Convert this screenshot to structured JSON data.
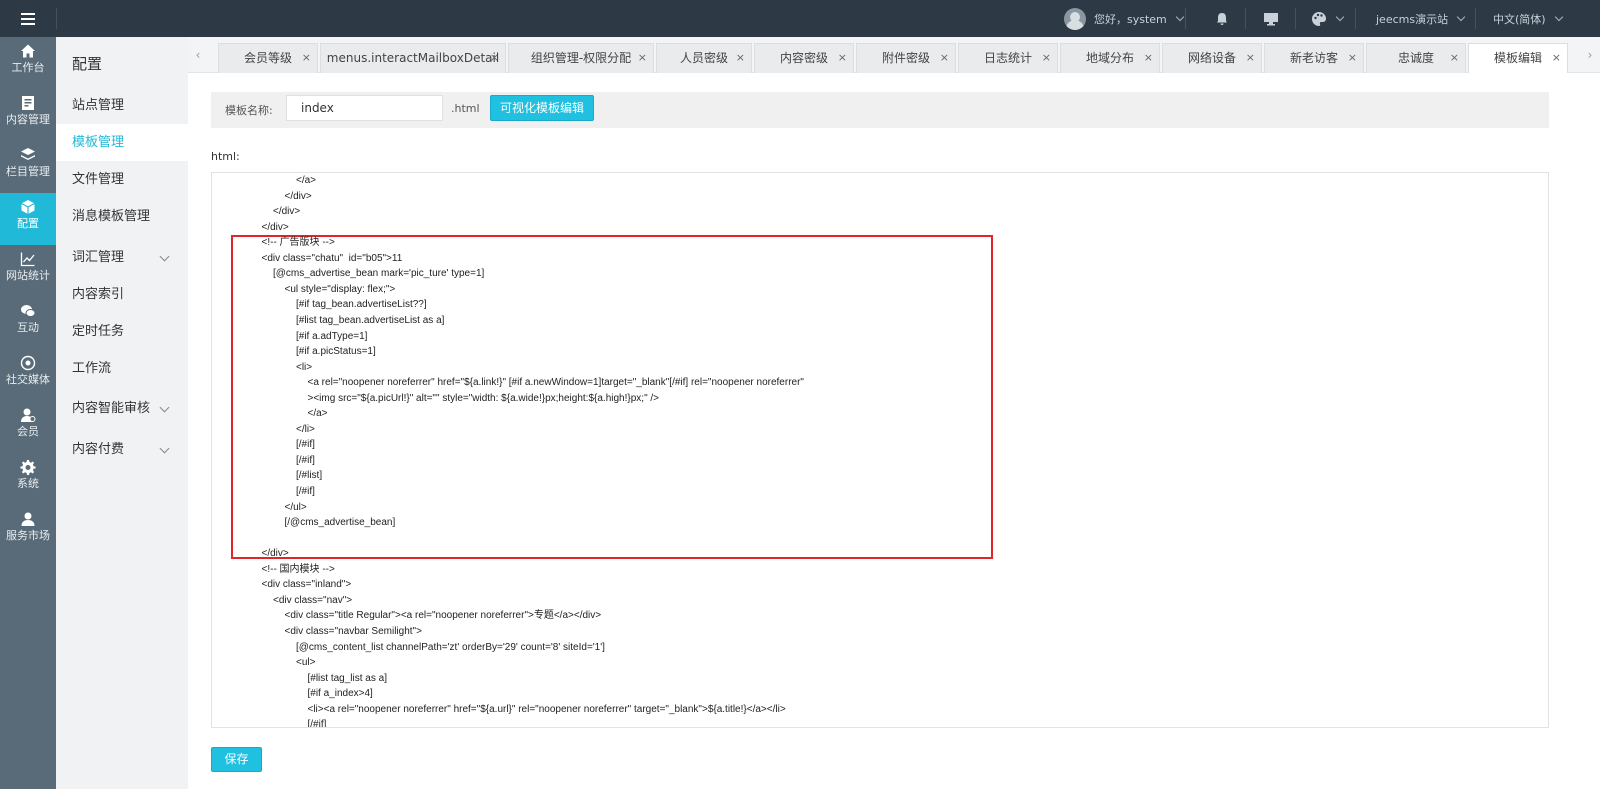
{
  "topbar": {
    "greeting": "您好，system",
    "site_name": "jeecms演示站",
    "language": "中文(简体)"
  },
  "icon_nav": [
    {
      "label": "工作台",
      "icon": "home-icon"
    },
    {
      "label": "内容管理",
      "icon": "document-icon"
    },
    {
      "label": "栏目管理",
      "icon": "layers-icon"
    },
    {
      "label": "配置",
      "icon": "cube-icon",
      "active": true
    },
    {
      "label": "网站统计",
      "icon": "chart-icon"
    },
    {
      "label": "互动",
      "icon": "chat-icon"
    },
    {
      "label": "社交媒体",
      "icon": "target-icon"
    },
    {
      "label": "会员",
      "icon": "member-icon"
    },
    {
      "label": "系统",
      "icon": "gear-icon"
    },
    {
      "label": "服务市场",
      "icon": "service-icon"
    }
  ],
  "sub_nav": {
    "title": "配置",
    "items": [
      {
        "label": "站点管理"
      },
      {
        "label": "模板管理",
        "active": true
      },
      {
        "label": "文件管理"
      },
      {
        "label": "消息模板管理"
      },
      {
        "label": "词汇管理",
        "expandable": true
      },
      {
        "label": "内容索引"
      },
      {
        "label": "定时任务"
      },
      {
        "label": "工作流"
      },
      {
        "label": "内容智能审核",
        "expandable": true
      },
      {
        "label": "内容付费",
        "expandable": true
      }
    ]
  },
  "tabs": [
    {
      "label": "会员等级"
    },
    {
      "label": "menus.interactMailboxDetail"
    },
    {
      "label": "组织管理-权限分配"
    },
    {
      "label": "人员密级"
    },
    {
      "label": "内容密级"
    },
    {
      "label": "附件密级"
    },
    {
      "label": "日志统计"
    },
    {
      "label": "地域分布"
    },
    {
      "label": "网络设备"
    },
    {
      "label": "新老访客"
    },
    {
      "label": "忠诚度"
    },
    {
      "label": "模板编辑",
      "active": true
    }
  ],
  "tab_close": "×",
  "tabs_prev": "‹",
  "tabs_next": "›",
  "template_form": {
    "name_label": "模板名称:",
    "name_value": "index",
    "suffix": ".html",
    "visual_edit_label": "可视化模板编辑",
    "html_label": "html:",
    "save_label": "保存"
  },
  "code_lines": [
    {
      "indent": 6,
      "text": "</a>"
    },
    {
      "indent": 5,
      "text": "</div>"
    },
    {
      "indent": 4,
      "text": "</div>"
    },
    {
      "indent": 3,
      "text": "</div>"
    },
    {
      "indent": 3,
      "text": "<!-- 广告版块 -->"
    },
    {
      "indent": 3,
      "text": "<div class=\"chatu\"  id=\"b05\">11"
    },
    {
      "indent": 4,
      "text": "[@cms_advertise_bean mark='pic_ture' type=1]"
    },
    {
      "indent": 5,
      "text": "<ul style=\"display: flex;\">"
    },
    {
      "indent": 6,
      "text": "[#if tag_bean.advertiseList??]"
    },
    {
      "indent": 6,
      "text": "[#list tag_bean.advertiseList as a]"
    },
    {
      "indent": 6,
      "text": "[#if a.adType=1]"
    },
    {
      "indent": 6,
      "text": "[#if a.picStatus=1]"
    },
    {
      "indent": 6,
      "text": "<li>"
    },
    {
      "indent": 7,
      "text": "<a rel=\"noopener noreferrer\" href=\"${a.link!}\" [#if a.newWindow=1]target=\"_blank\"[/#if] rel=\"noopener noreferrer\""
    },
    {
      "indent": 7,
      "text": "><img src=\"${a.picUrl!}\" alt=\"\" style=\"width: ${a.wide!}px;height:${a.high!}px;\" />"
    },
    {
      "indent": 7,
      "text": "</a>"
    },
    {
      "indent": 6,
      "text": "</li>"
    },
    {
      "indent": 6,
      "text": "[/#if]"
    },
    {
      "indent": 6,
      "text": "[/#if]"
    },
    {
      "indent": 6,
      "text": "[/#list]"
    },
    {
      "indent": 6,
      "text": "[/#if]"
    },
    {
      "indent": 5,
      "text": "</ul>"
    },
    {
      "indent": 5,
      "text": "[/@cms_advertise_bean]"
    },
    {
      "indent": 0,
      "text": ""
    },
    {
      "indent": 3,
      "text": "</div>"
    },
    {
      "indent": 3,
      "text": "<!-- 国内模块 -->"
    },
    {
      "indent": 3,
      "text": "<div class=\"inland\">"
    },
    {
      "indent": 4,
      "text": "<div class=\"nav\">"
    },
    {
      "indent": 5,
      "text": "<div class=\"title Regular\"><a rel=\"noopener noreferrer\">专题</a></div>"
    },
    {
      "indent": 5,
      "text": "<div class=\"navbar Semilight\">"
    },
    {
      "indent": 6,
      "text": "[@cms_content_list channelPath='zt' orderBy='29' count='8' siteId='1']"
    },
    {
      "indent": 6,
      "text": "<ul>"
    },
    {
      "indent": 7,
      "text": "[#list tag_list as a]"
    },
    {
      "indent": 7,
      "text": "[#if a_index>4]"
    },
    {
      "indent": 7,
      "text": "<li><a rel=\"noopener noreferrer\" href=\"${a.url}\" rel=\"noopener noreferrer\" target=\"_blank\">${a.title!}</a></li>"
    },
    {
      "indent": 7,
      "text": "[/#if]"
    }
  ],
  "colors": {
    "topbar_bg": "#2d3a46",
    "iconnav_bg": "#596b78",
    "accent": "#20bad8",
    "highlight_border": "#e0262a"
  }
}
